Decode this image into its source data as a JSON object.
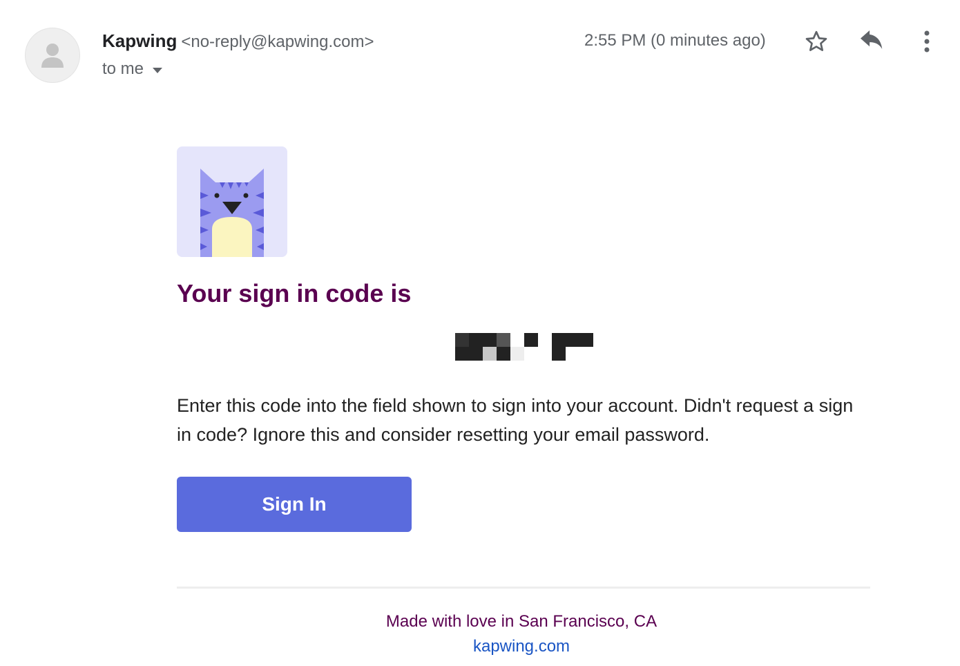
{
  "email_header": {
    "sender_name": "Kapwing",
    "sender_email": "<no-reply@kapwing.com>",
    "recipient": "to me",
    "timestamp": "2:55 PM (0 minutes ago)",
    "icons": [
      "person-icon",
      "chevron-down-icon",
      "star-icon",
      "reply-icon",
      "more-vert-icon"
    ]
  },
  "email_body": {
    "headline": "Your sign in code is",
    "code_redacted": true,
    "message": "Enter this code into the field shown to sign into your account. Didn't request a sign in code? Ignore this and consider resetting your email password.",
    "button_label": "Sign In",
    "footer_text": "Made with love in San Francisco, CA",
    "footer_link": "kapwing.com"
  },
  "colors": {
    "headline": "#5a0050",
    "button_bg": "#5a6bdd",
    "link": "#1a55c4",
    "logo_bg": "#e5e5fb",
    "cat_body": "#9b9bf0",
    "cat_belly": "#fbf5c0"
  }
}
